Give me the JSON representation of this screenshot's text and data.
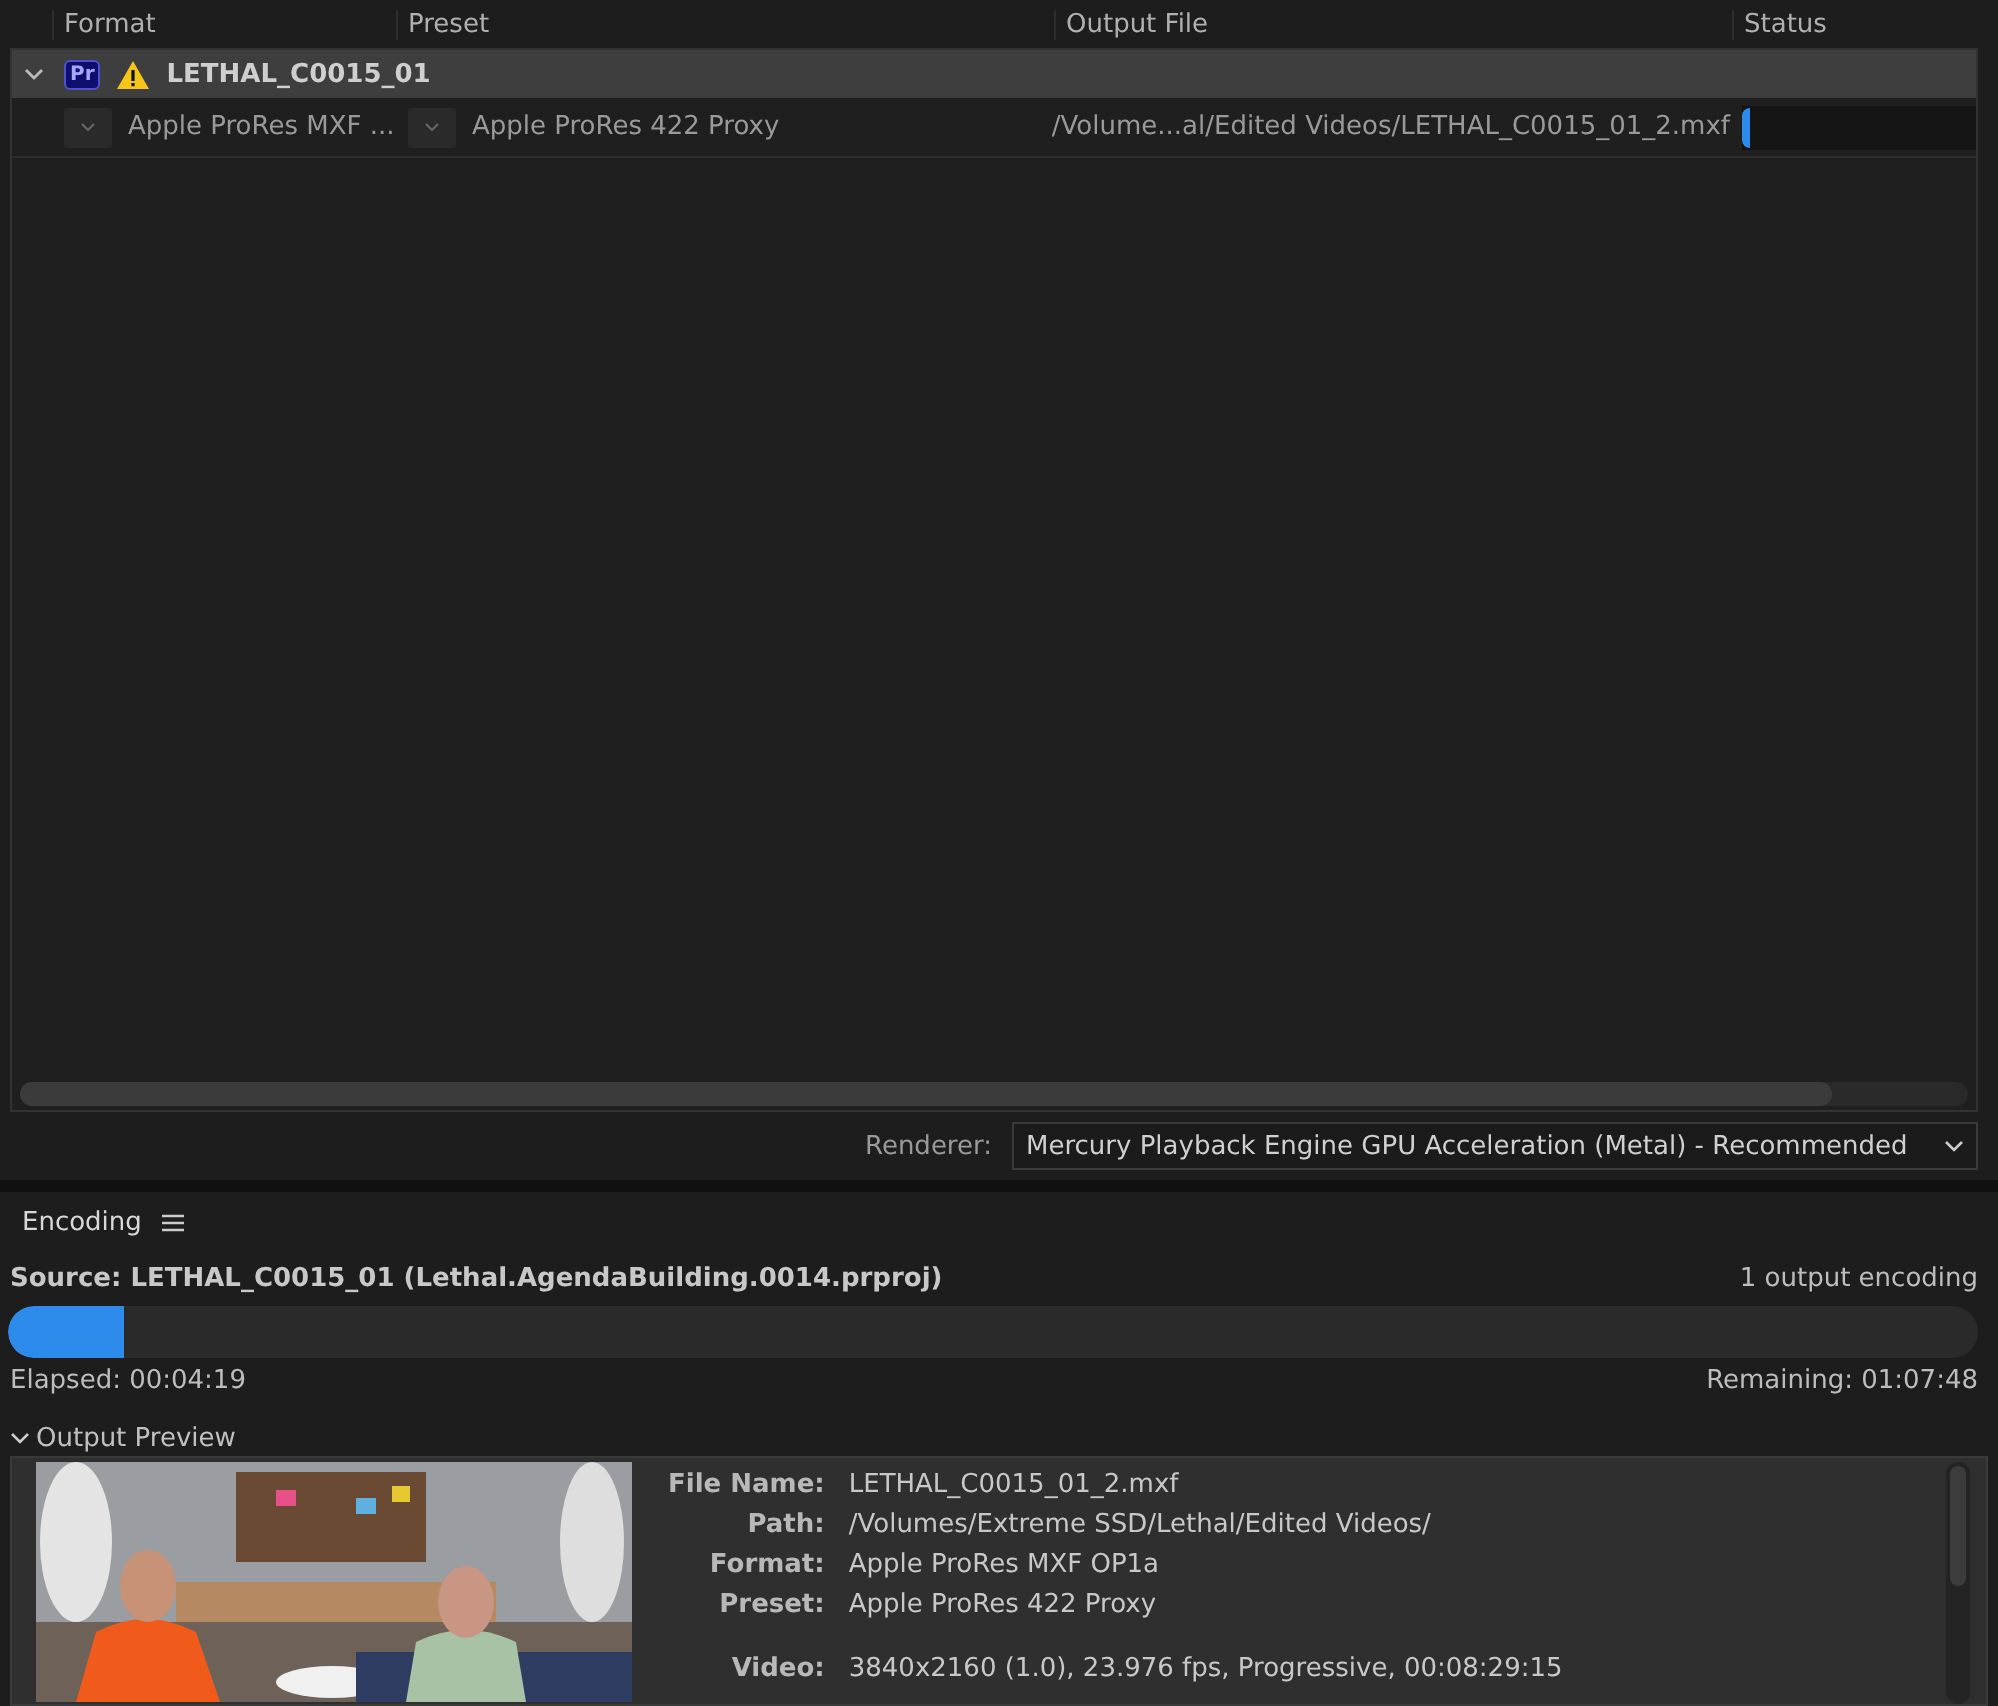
{
  "queue": {
    "columns": [
      "Format",
      "Preset",
      "Output File",
      "Status"
    ],
    "groups": [
      {
        "name": "LETHAL_C0015_01",
        "expanded": true,
        "badge": "Pr",
        "warning": true,
        "outputs": [
          {
            "format": "Apple ProRes MXF ...",
            "preset": "Apple ProRes 422 Proxy",
            "output_file": "/Volume...al/Edited Videos/LETHAL_C0015_01_2.mxf",
            "level": 0.03
          }
        ]
      }
    ]
  },
  "renderer": {
    "label": "Renderer:",
    "value": "Mercury Playback Engine GPU Acceleration (Metal) - Recommended"
  },
  "encoding": {
    "title": "Encoding",
    "source": "Source: LETHAL_C0015_01 (Lethal.AgendaBuilding.0014.prproj)",
    "count": "1 output encoding",
    "level": 0.059,
    "elapsed": "Elapsed: 00:04:19",
    "remaining": "Remaining: 01:07:48",
    "preview": {
      "title": "Output Preview",
      "expanded": true,
      "details": [
        {
          "label": "File Name:",
          "value": "LETHAL_C0015_01_2.mxf"
        },
        {
          "label": "Path:",
          "value": "/Volumes/Extreme SSD/Lethal/Edited Videos/"
        },
        {
          "label": "Format:",
          "value": "Apple ProRes MXF OP1a"
        },
        {
          "label": "Preset:",
          "value": "Apple ProRes 422 Proxy"
        },
        {
          "label": "Video:",
          "value": "3840x2160 (1.0), 23.976 fps, Progressive, 00:08:29:15",
          "gap": true
        }
      ]
    }
  }
}
